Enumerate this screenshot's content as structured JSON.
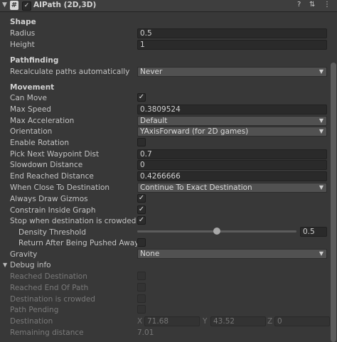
{
  "header": {
    "fold_icon": "triangle-down",
    "script_icon": "#",
    "enabled_check": "✓",
    "title": "AIPath (2D,3D)",
    "help_icon": "?",
    "settings_icon": "⇅",
    "menu_icon": "⋮"
  },
  "shape": {
    "section": "Shape",
    "radius_label": "Radius",
    "radius": "0.5",
    "height_label": "Height",
    "height": "1"
  },
  "pathfinding": {
    "section": "Pathfinding",
    "recalc_label": "Recalculate paths automatically",
    "recalc": "Never"
  },
  "movement": {
    "section": "Movement",
    "can_move_label": "Can Move",
    "can_move": "✓",
    "max_speed_label": "Max Speed",
    "max_speed": "0.3809524",
    "max_acceleration_label": "Max Acceleration",
    "max_acceleration": "Default",
    "orientation_label": "Orientation",
    "orientation": "YAxisForward (for 2D games)",
    "enable_rotation_label": "Enable Rotation",
    "pick_next_label": "Pick Next Waypoint Dist",
    "pick_next": "0.7",
    "slowdown_label": "Slowdown Distance",
    "slowdown": "0",
    "end_reached_label": "End Reached Distance",
    "end_reached": "0.4266666",
    "when_close_label": "When Close To Destination",
    "when_close": "Continue To Exact Destination",
    "always_gizmos_label": "Always Draw Gizmos",
    "always_gizmos": "✓",
    "constrain_label": "Constrain Inside Graph",
    "constrain": "✓",
    "stop_crowded_label": "Stop when destination is crowded",
    "stop_crowded": "✓",
    "density_label": "Density Threshold",
    "density": "0.5",
    "return_after_label": "Return After Being Pushed Away",
    "gravity_label": "Gravity",
    "gravity": "None"
  },
  "debug": {
    "section": "Debug info",
    "reached_destination_label": "Reached Destination",
    "reached_end_label": "Reached End Of Path",
    "dest_crowded_label": "Destination is crowded",
    "path_pending_label": "Path Pending",
    "destination_label": "Destination",
    "x_label": "X",
    "x": "71.68",
    "y_label": "Y",
    "y": "43.52",
    "z_label": "Z",
    "z": "0",
    "remaining_label": "Remaining distance",
    "remaining": "7.01"
  }
}
